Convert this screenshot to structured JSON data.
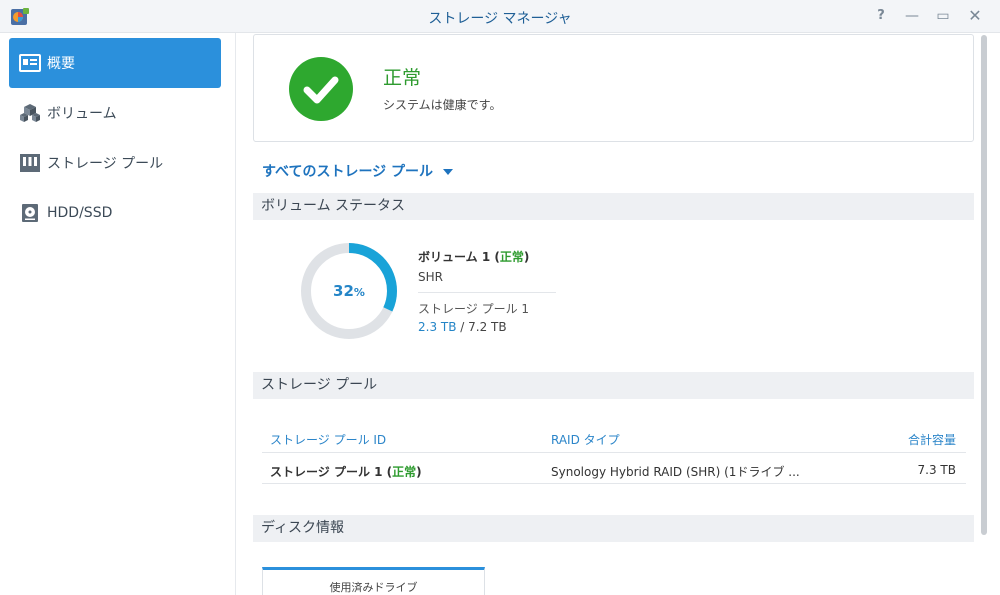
{
  "window": {
    "title": "ストレージ マネージャ",
    "controls": {
      "help": "?",
      "minimize": "—",
      "maximize": "▭",
      "close": "✕"
    }
  },
  "sidebar": {
    "items": [
      {
        "label": "概要",
        "icon": "overview-icon",
        "active": true
      },
      {
        "label": "ボリューム",
        "icon": "volume-icon",
        "active": false
      },
      {
        "label": "ストレージ プール",
        "icon": "storage-pool-icon",
        "active": false
      },
      {
        "label": "HDD/SSD",
        "icon": "hdd-icon",
        "active": false
      }
    ]
  },
  "status": {
    "title": "正常",
    "description": "システムは健康です。",
    "color": "#2ea82f"
  },
  "pool_selector": {
    "label": "すべてのストレージ プール"
  },
  "volume_status": {
    "header": "ボリューム ステータス",
    "percent": 32,
    "percent_text": "32",
    "percent_unit": "%",
    "name": "ボリューム 1 (",
    "state": "正常",
    "name_close": ")",
    "raid": "SHR",
    "pool": "ストレージ プール 1",
    "used": "2.3 TB",
    "separator": " / ",
    "total": "7.2 TB",
    "accent_color": "#19a3d8"
  },
  "storage_pool": {
    "header": "ストレージ プール",
    "columns": [
      "ストレージ プール ID",
      "RAID タイプ",
      "合計容量"
    ],
    "rows": [
      {
        "name": "ストレージ プール 1 (",
        "state": "正常",
        "name_close": ")",
        "raid": "Synology Hybrid RAID (SHR) (1ドライブ ...",
        "capacity": "7.3 TB"
      }
    ]
  },
  "disk_info": {
    "header": "ディスク情報",
    "tab_label": "使用済みドライブ"
  }
}
